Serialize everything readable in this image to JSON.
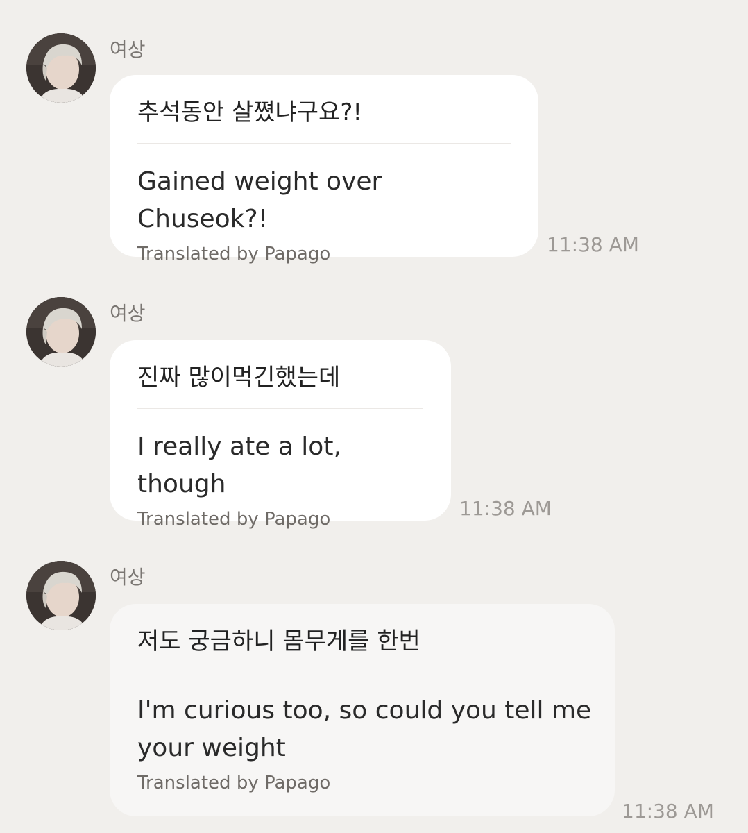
{
  "messages": [
    {
      "sender": "여상",
      "avatar_icon": "profile-photo-icon",
      "original": "추석동안 살쪘냐구요?!",
      "translation": "Gained weight over Chuseok?!",
      "credit": "Translated by Papago",
      "time": "11:38 AM"
    },
    {
      "sender": "여상",
      "avatar_icon": "profile-photo-icon",
      "original": "진짜 많이먹긴했는데",
      "translation": "I really ate a lot, though",
      "credit": "Translated by Papago",
      "time": "11:38 AM"
    },
    {
      "sender": "여상",
      "avatar_icon": "profile-photo-icon",
      "original": "저도 궁금하니 몸무게를 한번",
      "translation": "I'm curious too, so could you tell me your weight",
      "credit": "Translated by Papago",
      "time": "11:38 AM"
    }
  ],
  "colors": {
    "background": "#f1efec",
    "bubble": "#ffffff",
    "timestamp": "#9d9995"
  }
}
